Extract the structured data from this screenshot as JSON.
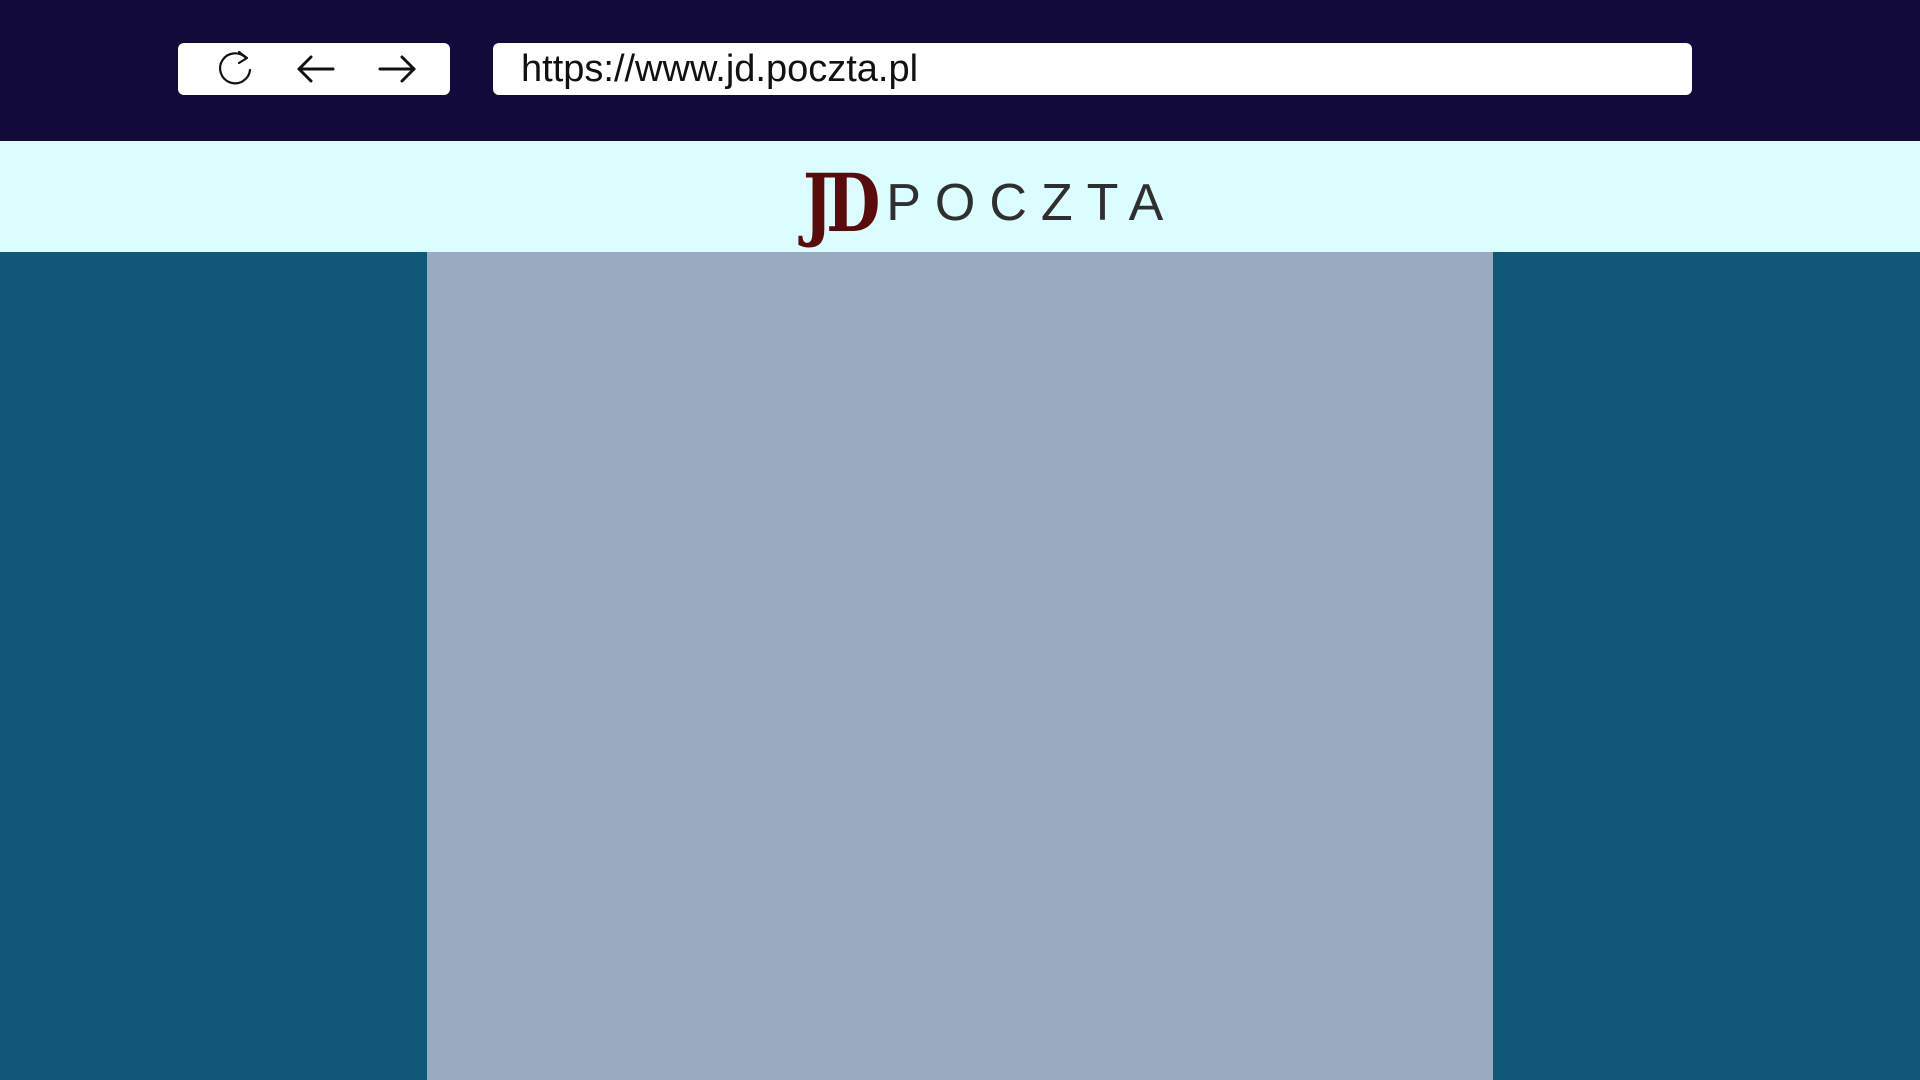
{
  "browser": {
    "url": "https://www.jd.poczta.pl",
    "controls": {
      "reload_icon": "reload-icon",
      "back_icon": "arrow-left-icon",
      "forward_icon": "arrow-right-icon"
    }
  },
  "site": {
    "logo_mark": "JD",
    "logo_word": "POCZTA"
  },
  "colors": {
    "browser_bar": "#120a3a",
    "header_bg": "#dbfdff",
    "side_bg": "#115878",
    "content_bg": "#98abc1",
    "logo_mark": "#5a0b0b",
    "logo_word": "#2f2f2f"
  }
}
